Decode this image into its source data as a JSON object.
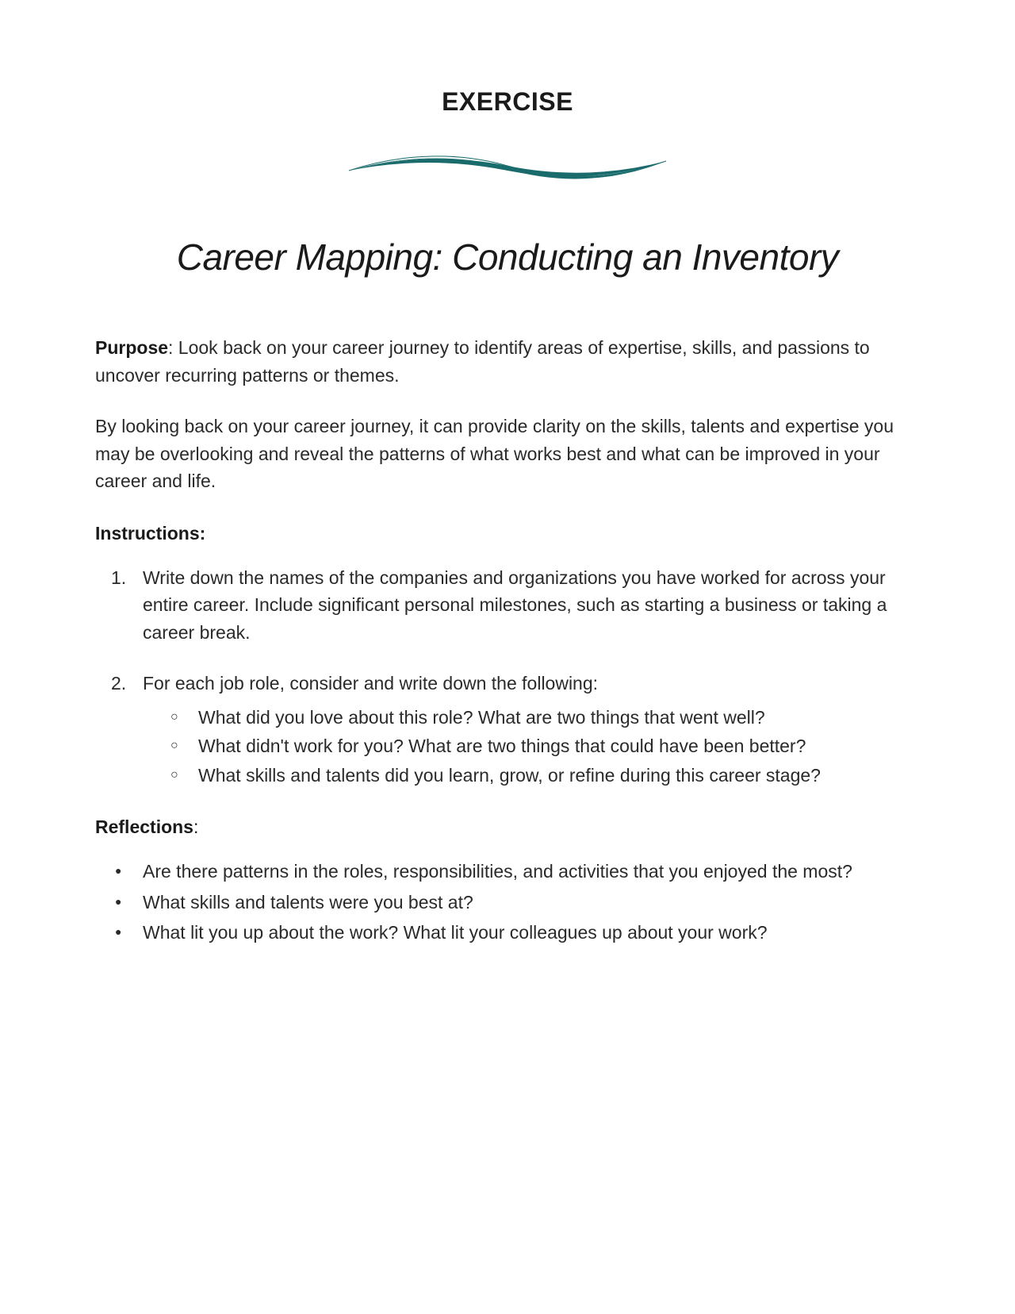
{
  "header": {
    "label": "EXERCISE"
  },
  "title": "Career Mapping: Conducting an Inventory",
  "purpose": {
    "label": "Purpose",
    "text": ": Look back on your career journey to identify areas of expertise, skills, and passions to uncover recurring patterns or themes."
  },
  "intro_paragraph": "By looking back on your career journey, it can provide clarity on the skills, talents and expertise you may be overlooking and reveal the patterns of what works best and what can be improved in your career and life.",
  "instructions": {
    "heading": "Instructions:",
    "items": [
      {
        "number": "1.",
        "text": "Write down the names of the companies and organizations you have worked for across your entire career. Include significant personal milestones, such as starting a business or taking a career break."
      },
      {
        "number": "2.",
        "text": "For each job role, consider and write down the following:",
        "subitems": [
          "What did you love about this role? What are two things that went well?",
          "What didn't work for you? What are two things that could have been better?",
          "What skills and talents did you learn, grow, or refine during this career stage?"
        ]
      }
    ]
  },
  "reflections": {
    "heading": "Reflections",
    "heading_suffix": ":",
    "items": [
      "Are there patterns in the roles, responsibilities, and activities that you enjoyed the most?",
      "What skills and talents were you best at?",
      "What lit you up about the work? What lit your colleagues up about your work?"
    ]
  },
  "colors": {
    "wave": "#1a6b6b"
  }
}
